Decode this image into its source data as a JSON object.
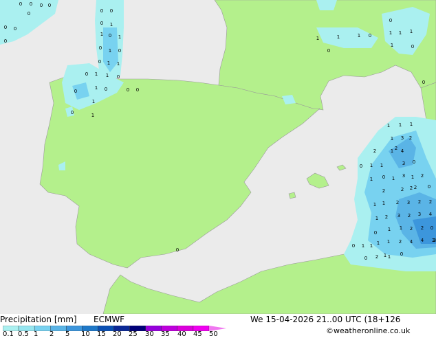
{
  "title_left": "Precipitation [mm]",
  "model": "ECMWF",
  "valid_time": "We 15-04-2026 21..00 UTC (18+126",
  "credit": "©weatheronline.co.uk",
  "legend": {
    "ticks": [
      "0.1",
      "0.5",
      "1",
      "2",
      "5",
      "10",
      "15",
      "20",
      "25",
      "30",
      "35",
      "40",
      "45",
      "50"
    ],
    "colors": [
      "#aaf0f0",
      "#96e6f0",
      "#78d2f0",
      "#5ab4e6",
      "#3c96dc",
      "#1e78c8",
      "#0a50b4",
      "#0a2896",
      "#000078",
      "#9600dc",
      "#be00dc",
      "#dc00dc",
      "#f000f0",
      "#f078f0"
    ]
  },
  "map_colors": {
    "sea": "#ebebeb",
    "land": "#b4f08c",
    "precip_light": "#aaf0f0",
    "precip_mid": "#78d2f0",
    "precip_heavy": "#3c96dc"
  },
  "precip_values": [
    "0",
    "0",
    "0",
    "0",
    "0",
    "0",
    "0",
    "0",
    "0",
    "0",
    "1",
    "0",
    "1",
    "0",
    "1",
    "1",
    "0",
    "0",
    "1",
    "0",
    "1",
    "0",
    "1",
    "1",
    "0",
    "0",
    "1",
    "0",
    "1",
    "0",
    "0",
    "1",
    "0",
    "0",
    "1",
    "1",
    "1",
    "0",
    "1",
    "1",
    "4",
    "3",
    "0",
    "1",
    "1",
    "3",
    "0",
    "0",
    "1",
    "1",
    "1",
    "1",
    "1",
    "2",
    "1",
    "2",
    "2",
    "1",
    "0",
    "1",
    "2",
    "1",
    "2",
    "3",
    "1",
    "2",
    "1",
    "2",
    "2",
    "2",
    "3",
    "3",
    "2",
    "1",
    "1",
    "1",
    "2",
    "4",
    "4",
    "4",
    "1",
    "0",
    "1",
    "2",
    "3",
    "1",
    "0",
    "1",
    "1",
    "0",
    "0",
    "0",
    "2",
    "2",
    "2",
    "2",
    "0",
    "3",
    "1",
    "2",
    "0",
    "1",
    "0",
    "3",
    "0"
  ]
}
